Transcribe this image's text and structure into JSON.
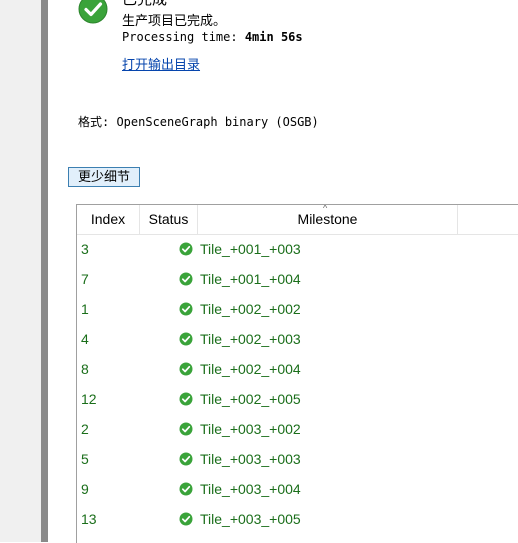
{
  "status": {
    "title_partial": "已完成",
    "done_text": "生产项目已完成。",
    "processing_label": "Processing time: ",
    "processing_value": "4min 56s",
    "open_output_link": "打开输出目录",
    "format_text": "格式: OpenSceneGraph binary (OSGB)"
  },
  "less_details_button": "更少细节",
  "grid": {
    "headers": {
      "index": "Index",
      "status": "Status",
      "milestone": "Milestone"
    },
    "rows": [
      {
        "index": "3",
        "status": "ok-icon",
        "milestone": "Tile_+001_+003"
      },
      {
        "index": "7",
        "status": "ok-icon",
        "milestone": "Tile_+001_+004"
      },
      {
        "index": "1",
        "status": "ok-icon",
        "milestone": "Tile_+002_+002"
      },
      {
        "index": "4",
        "status": "ok-icon",
        "milestone": "Tile_+002_+003"
      },
      {
        "index": "8",
        "status": "ok-icon",
        "milestone": "Tile_+002_+004"
      },
      {
        "index": "12",
        "status": "ok-icon",
        "milestone": "Tile_+002_+005"
      },
      {
        "index": "2",
        "status": "ok-icon",
        "milestone": "Tile_+003_+002"
      },
      {
        "index": "5",
        "status": "ok-icon",
        "milestone": "Tile_+003_+003"
      },
      {
        "index": "9",
        "status": "ok-icon",
        "milestone": "Tile_+003_+004"
      },
      {
        "index": "13",
        "status": "ok-icon",
        "milestone": "Tile_+003_+005"
      }
    ]
  },
  "colors": {
    "success_green": "#1a6e1a",
    "check_green": "#3aa33a",
    "link_blue": "#0645ad"
  }
}
